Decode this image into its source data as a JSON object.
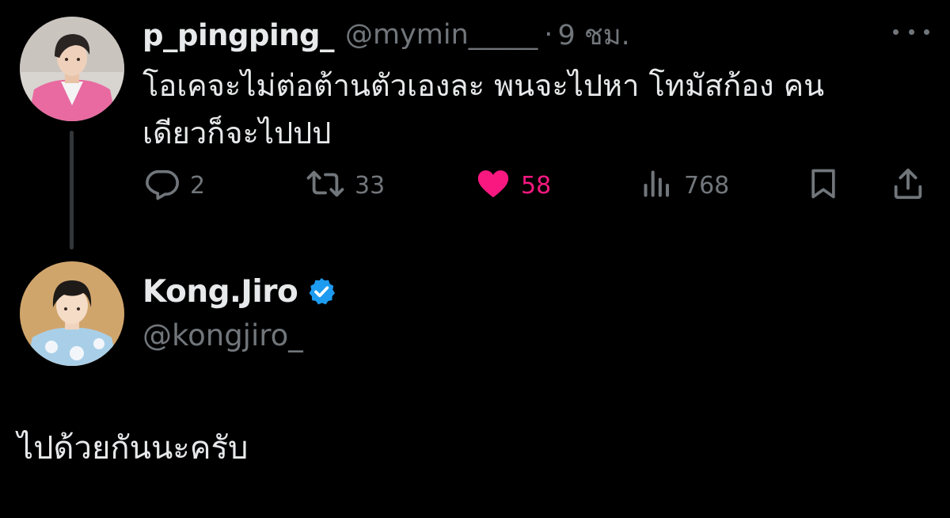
{
  "parent_tweet": {
    "display_name": "p_pingping_",
    "handle": "@mymin_____",
    "separator": "·",
    "time": "9 ชม.",
    "text_lines": [
      "โอเคจะไม่ต่อต้านตัวเองละ พนจะไปหา โทมัสก้อง คน",
      "เดียวก็จะไปปป"
    ],
    "actions": {
      "reply_count": "2",
      "retweet_count": "33",
      "like_count": "58",
      "views_count": "768"
    },
    "liked": true
  },
  "reply_tweet": {
    "display_name": "Kong.Jiro",
    "verified": true,
    "handle": "@kongjiro_",
    "text": "ไปด้วยกันนะครับ"
  },
  "icons": {
    "reply": "reply-bubble-icon",
    "retweet": "retweet-icon",
    "like": "heart-filled-icon",
    "views": "views-bars-icon",
    "bookmark": "bookmark-icon",
    "share": "share-upload-icon",
    "more": "more-dots-icon",
    "verified": "verified-badge-icon"
  },
  "colors": {
    "background": "#000000",
    "primary_text": "#e7e9ea",
    "secondary_text": "#71767b",
    "like": "#f91880",
    "verified": "#1d9bf0",
    "thread_line": "#333639"
  }
}
